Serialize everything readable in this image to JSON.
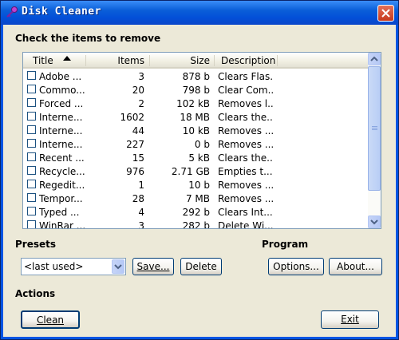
{
  "window": {
    "title": "Disk Cleaner"
  },
  "list_label": "Check the items to remove",
  "columns": [
    "Title",
    "Items",
    "Size",
    "Description"
  ],
  "rows": [
    {
      "title": "Adobe ...",
      "items": "3",
      "size": "878 b",
      "desc": "Clears Flas..."
    },
    {
      "title": "Commo...",
      "items": "20",
      "size": "798 b",
      "desc": "Clear Com..."
    },
    {
      "title": "Forced ...",
      "items": "2",
      "size": "102 kB",
      "desc": "Removes l..."
    },
    {
      "title": "Interne...",
      "items": "1602",
      "size": "18 MB",
      "desc": "Clears the..."
    },
    {
      "title": "Interne...",
      "items": "44",
      "size": "10 kB",
      "desc": "Removes ..."
    },
    {
      "title": "Interne...",
      "items": "227",
      "size": "0 b",
      "desc": "Removes ..."
    },
    {
      "title": "Recent ...",
      "items": "15",
      "size": "5 kB",
      "desc": "Clears the..."
    },
    {
      "title": "Recycle...",
      "items": "976",
      "size": "2.71 GB",
      "desc": "Empties t..."
    },
    {
      "title": "Regedit...",
      "items": "1",
      "size": "10 b",
      "desc": "Removes ..."
    },
    {
      "title": "Tempor...",
      "items": "28",
      "size": "7 MB",
      "desc": "Removes ..."
    },
    {
      "title": "Typed ...",
      "items": "4",
      "size": "292 b",
      "desc": "Clears Int..."
    },
    {
      "title": "WinRar ...",
      "items": "3",
      "size": "282 b",
      "desc": "Delete Wi..."
    }
  ],
  "presets": {
    "label": "Presets",
    "selected": "<last used>",
    "save": "Save...",
    "delete": "Delete"
  },
  "program": {
    "label": "Program",
    "options": "Options...",
    "about": "About..."
  },
  "actions": {
    "label": "Actions",
    "clean": "Clean",
    "exit": "Exit"
  }
}
